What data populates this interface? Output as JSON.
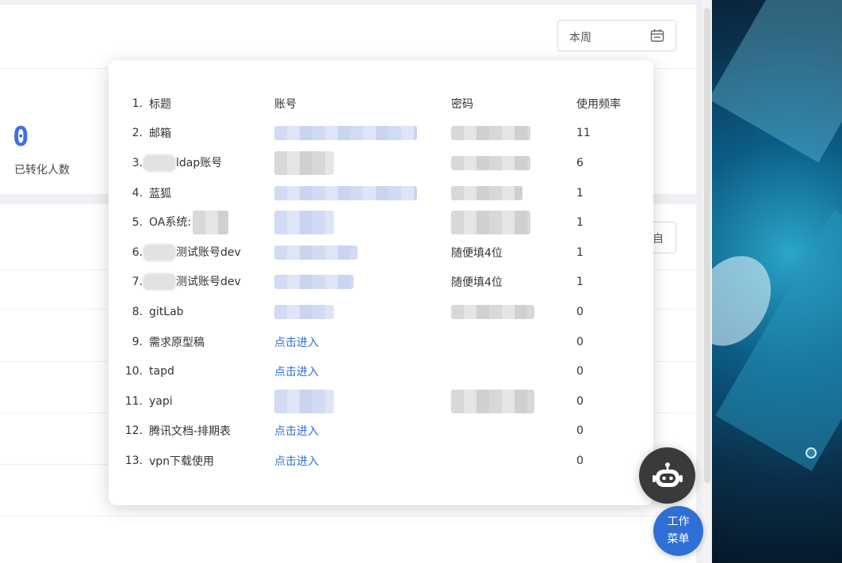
{
  "dashboard": {
    "date_range": "本周",
    "stat_value": "0",
    "stat_label": "已转化人数",
    "ghost_button_label": "自"
  },
  "popup": {
    "rows": [
      {
        "no": "1.",
        "title": "标题",
        "account": "账号",
        "password": "密码",
        "frequency": "使用频率"
      },
      {
        "no": "2.",
        "title": "邮箱",
        "account": "",
        "password": "",
        "frequency": "11"
      },
      {
        "no": "3.",
        "title": "ldap账号",
        "account": "",
        "password": "",
        "frequency": "6"
      },
      {
        "no": "4.",
        "title": "蓝狐",
        "account": "",
        "password": "",
        "frequency": "1"
      },
      {
        "no": "5.",
        "title": "OA系统:",
        "account": "",
        "password": "",
        "frequency": "1"
      },
      {
        "no": "6.",
        "title": "测试账号dev",
        "account": "",
        "password": "随便填4位",
        "frequency": "1"
      },
      {
        "no": "7.",
        "title": "测试账号dev",
        "account": "",
        "password": "随便填4位",
        "frequency": "1"
      },
      {
        "no": "8.",
        "title": "gitLab",
        "account": "",
        "password": "",
        "frequency": "0"
      },
      {
        "no": "9.",
        "title": "需求原型稿",
        "account": "点击进入",
        "password": "",
        "frequency": "0"
      },
      {
        "no": "10.",
        "title": "tapd",
        "account": "点击进入",
        "password": "",
        "frequency": "0"
      },
      {
        "no": "11.",
        "title": "yapi",
        "account": "",
        "password": "",
        "frequency": "0"
      },
      {
        "no": "12.",
        "title": "腾讯文档-排期表",
        "account": "点击进入",
        "password": "",
        "frequency": "0"
      },
      {
        "no": "13.",
        "title": "vpn下载使用",
        "account": "点击进入",
        "password": "",
        "frequency": "0"
      }
    ]
  },
  "floating": {
    "menu_line1": "工作",
    "menu_line2": "菜单",
    "bot_icon": "robot-icon"
  },
  "colors": {
    "accent": "#2f6fd6",
    "stat": "#3d6fe8",
    "bot_bg": "#3a3a3a"
  }
}
